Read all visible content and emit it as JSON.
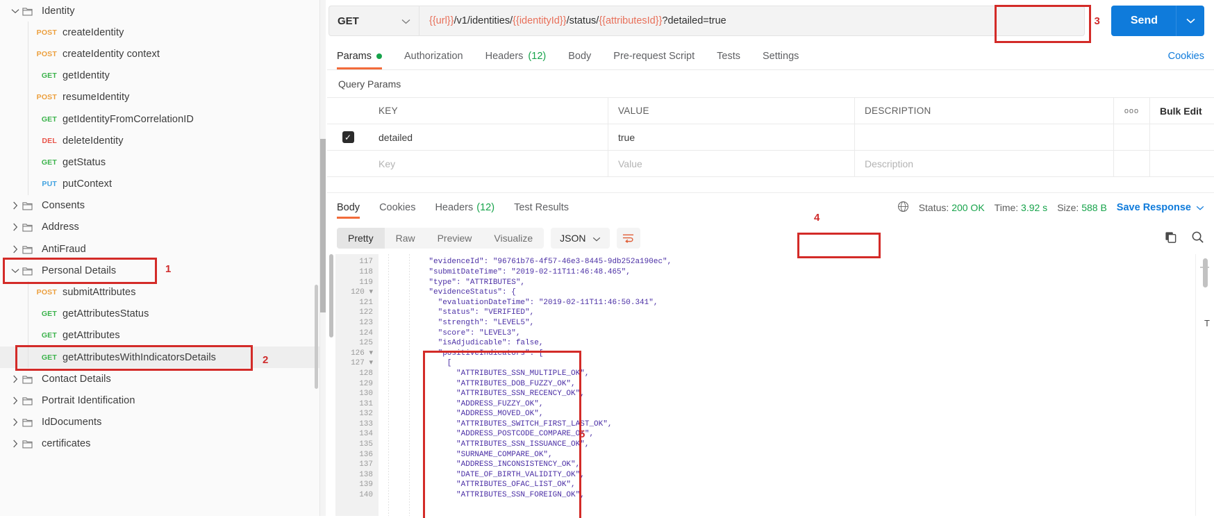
{
  "sidebar": {
    "items": [
      {
        "type": "folder",
        "label": "Identity",
        "expanded": true,
        "chevron": "chevron-down-icon"
      },
      {
        "type": "request",
        "method": "POST",
        "label": "createIdentity"
      },
      {
        "type": "request",
        "method": "POST",
        "label": "createIdentity context"
      },
      {
        "type": "request",
        "method": "GET",
        "label": "getIdentity"
      },
      {
        "type": "request",
        "method": "POST",
        "label": "resumeIdentity"
      },
      {
        "type": "request",
        "method": "GET",
        "label": "getIdentityFromCorrelationID"
      },
      {
        "type": "request",
        "method": "DEL",
        "label": "deleteIdentity"
      },
      {
        "type": "request",
        "method": "GET",
        "label": "getStatus"
      },
      {
        "type": "request",
        "method": "PUT",
        "label": "putContext"
      },
      {
        "type": "folder",
        "label": "Consents",
        "expanded": false,
        "chevron": "chevron-right-icon"
      },
      {
        "type": "folder",
        "label": "Address",
        "expanded": false,
        "chevron": "chevron-right-icon"
      },
      {
        "type": "folder",
        "label": "AntiFraud",
        "expanded": false,
        "chevron": "chevron-right-icon"
      },
      {
        "type": "folder",
        "label": "Personal Details",
        "expanded": true,
        "chevron": "chevron-down-icon",
        "highlight": "1"
      },
      {
        "type": "request",
        "method": "POST",
        "label": "submitAttributes"
      },
      {
        "type": "request",
        "method": "GET",
        "label": "getAttributesStatus"
      },
      {
        "type": "request",
        "method": "GET",
        "label": "getAttributes"
      },
      {
        "type": "request",
        "method": "GET",
        "label": "getAttributesWithIndicatorsDetails",
        "selected": true,
        "highlight": "2"
      },
      {
        "type": "folder",
        "label": "Contact Details",
        "expanded": false,
        "chevron": "chevron-right-icon"
      },
      {
        "type": "folder",
        "label": "Portrait Identification",
        "expanded": false,
        "chevron": "chevron-right-icon"
      },
      {
        "type": "folder",
        "label": "IdDocuments",
        "expanded": false,
        "chevron": "chevron-right-icon"
      },
      {
        "type": "folder",
        "label": "certificates",
        "expanded": false,
        "chevron": "chevron-right-icon"
      }
    ]
  },
  "request": {
    "method": "GET",
    "url_parts": [
      {
        "text": "{{url}}",
        "variable": true
      },
      {
        "text": "/v1/identities/",
        "variable": false
      },
      {
        "text": "{{identityId}}",
        "variable": true
      },
      {
        "text": "/status/",
        "variable": false
      },
      {
        "text": "{{attributesId}}",
        "variable": true
      },
      {
        "text": "?detailed=true",
        "variable": false
      }
    ],
    "url_full": "{{url}}/v1/identities/{{identityId}}/status/{{attributesId}}?detailed=true",
    "send_label": "Send",
    "send_marker": "3",
    "tabs": [
      {
        "label": "Params",
        "active": true,
        "dot": true
      },
      {
        "label": "Authorization",
        "active": false
      },
      {
        "label": "Headers",
        "count": "(12)",
        "active": false
      },
      {
        "label": "Body",
        "active": false
      },
      {
        "label": "Pre-request Script",
        "active": false
      },
      {
        "label": "Tests",
        "active": false
      },
      {
        "label": "Settings",
        "active": false
      }
    ],
    "cookies_link": "Cookies"
  },
  "query_params": {
    "section_title": "Query Params",
    "headers": {
      "key": "KEY",
      "value": "VALUE",
      "description": "DESCRIPTION",
      "bulk_edit": "Bulk Edit",
      "dots": "ooo"
    },
    "rows": [
      {
        "checked": true,
        "key": "detailed",
        "value": "true",
        "description": ""
      }
    ],
    "placeholder_row": {
      "key": "Key",
      "value": "Value",
      "description": "Description"
    }
  },
  "response": {
    "marker": "4",
    "tabs": [
      {
        "label": "Body",
        "active": true
      },
      {
        "label": "Cookies",
        "active": false
      },
      {
        "label": "Headers",
        "count": "(12)",
        "active": false
      },
      {
        "label": "Test Results",
        "active": false
      }
    ],
    "status_label": "Status:",
    "status_value": "200 OK",
    "time_label": "Time:",
    "time_value": "3.92 s",
    "size_label": "Size:",
    "size_value": "588 B",
    "save_response": "Save Response",
    "format_tabs": [
      {
        "label": "Pretty",
        "active": true
      },
      {
        "label": "Raw",
        "active": false
      },
      {
        "label": "Preview",
        "active": false
      },
      {
        "label": "Visualize",
        "active": false
      }
    ],
    "language": "JSON",
    "body_marker": "5",
    "code_lines": [
      {
        "no": "117",
        "fold": false,
        "indent": 4,
        "text": "\"evidenceId\": \"96761b76-4f57-46e3-8445-9db252a190ec\","
      },
      {
        "no": "118",
        "fold": false,
        "indent": 4,
        "text": "\"submitDateTime\": \"2019-02-11T11:46:48.465\","
      },
      {
        "no": "119",
        "fold": false,
        "indent": 4,
        "text": "\"type\": \"ATTRIBUTES\","
      },
      {
        "no": "120",
        "fold": true,
        "indent": 4,
        "text": "\"evidenceStatus\": {"
      },
      {
        "no": "121",
        "fold": false,
        "indent": 6,
        "text": "\"evaluationDateTime\": \"2019-02-11T11:46:50.341\","
      },
      {
        "no": "122",
        "fold": false,
        "indent": 6,
        "text": "\"status\": \"VERIFIED\","
      },
      {
        "no": "123",
        "fold": false,
        "indent": 6,
        "text": "\"strength\": \"LEVEL5\","
      },
      {
        "no": "124",
        "fold": false,
        "indent": 6,
        "text": "\"score\": \"LEVEL3\","
      },
      {
        "no": "125",
        "fold": false,
        "indent": 6,
        "text": "\"isAdjudicable\": false,"
      },
      {
        "no": "126",
        "fold": true,
        "indent": 6,
        "text": "\"positiveIndicators\": ["
      },
      {
        "no": "127",
        "fold": true,
        "indent": 8,
        "text": "["
      },
      {
        "no": "128",
        "fold": false,
        "indent": 10,
        "text": "\"ATTRIBUTES_SSN_MULTIPLE_OK\","
      },
      {
        "no": "129",
        "fold": false,
        "indent": 10,
        "text": "\"ATTRIBUTES_DOB_FUZZY_OK\","
      },
      {
        "no": "130",
        "fold": false,
        "indent": 10,
        "text": "\"ATTRIBUTES_SSN_RECENCY_OK\","
      },
      {
        "no": "131",
        "fold": false,
        "indent": 10,
        "text": "\"ADDRESS_FUZZY_OK\","
      },
      {
        "no": "132",
        "fold": false,
        "indent": 10,
        "text": "\"ADDRESS_MOVED_OK\","
      },
      {
        "no": "133",
        "fold": false,
        "indent": 10,
        "text": "\"ATTRIBUTES_SWITCH_FIRST_LAST_OK\","
      },
      {
        "no": "134",
        "fold": false,
        "indent": 10,
        "text": "\"ADDRESS_POSTCODE_COMPARE_OK\","
      },
      {
        "no": "135",
        "fold": false,
        "indent": 10,
        "text": "\"ATTRIBUTES_SSN_ISSUANCE_OK\","
      },
      {
        "no": "136",
        "fold": false,
        "indent": 10,
        "text": "\"SURNAME_COMPARE_OK\","
      },
      {
        "no": "137",
        "fold": false,
        "indent": 10,
        "text": "\"ADDRESS_INCONSISTENCY_OK\","
      },
      {
        "no": "138",
        "fold": false,
        "indent": 10,
        "text": "\"DATE_OF_BIRTH_VALIDITY_OK\","
      },
      {
        "no": "139",
        "fold": false,
        "indent": 10,
        "text": "\"ATTRIBUTES_OFAC_LIST_OK\","
      },
      {
        "no": "140",
        "fold": false,
        "indent": 10,
        "text": "\"ATTRIBUTES_SSN_FOREIGN_OK\","
      }
    ]
  },
  "colors": {
    "accent_orange": "#f26b3a",
    "send_blue": "#0f7bdb",
    "highlight_red": "#d32b28",
    "status_green": "#16a34a",
    "var_red": "#e8705a"
  }
}
